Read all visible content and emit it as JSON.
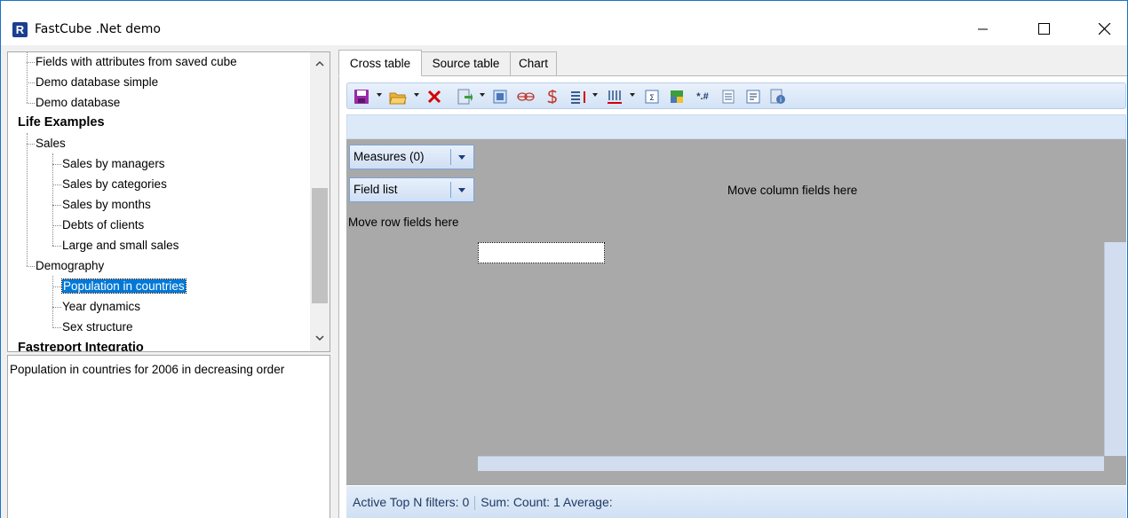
{
  "window": {
    "title": "FastCube .Net demo",
    "app_icon_letter": "R"
  },
  "tree": {
    "items": [
      {
        "label": "Fields with attributes from saved cube"
      },
      {
        "label": "Demo database simple"
      },
      {
        "label": "Demo database"
      },
      {
        "label": "Life Examples"
      },
      {
        "label": "Sales"
      },
      {
        "label": "Sales by managers"
      },
      {
        "label": "Sales by categories"
      },
      {
        "label": "Sales by months"
      },
      {
        "label": "Debts of clients"
      },
      {
        "label": "Large and small sales"
      },
      {
        "label": "Demography"
      },
      {
        "label": "Population in countries"
      },
      {
        "label": "Year dynamics"
      },
      {
        "label": "Sex structure"
      },
      {
        "label": "Fastreport Integratio"
      }
    ],
    "selected": "Population in countries"
  },
  "description": "Population in countries for 2006 in decreasing order",
  "tabs": [
    {
      "label": "Cross table"
    },
    {
      "label": "Source table"
    },
    {
      "label": "Chart"
    }
  ],
  "toolbar": {
    "icons": [
      "save-icon",
      "open-folder-icon",
      "delete-icon",
      "export-icon",
      "grid-icon",
      "infinity-icon",
      "currency-icon",
      "sort-icon",
      "columns-icon",
      "sum-icon",
      "color-scale-icon",
      "number-format-icon",
      "list-icon",
      "properties-icon",
      "info-icon"
    ],
    "number_format_label": "*.#"
  },
  "grid": {
    "measures_label": "Measures (0)",
    "field_list_label": "Field list",
    "column_fields_hint": "Move column fields here",
    "row_fields_hint": "Move row fields here"
  },
  "status": {
    "filters": "Active Top N filters: 0",
    "aggregates": "Sum:  Count: 1 Average:"
  },
  "colors": {
    "selection": "#0078d7",
    "grid_background": "#a9a9a9",
    "toolbar_blue": "#d3e3f6",
    "delete_red": "#d40000",
    "save_purple": "#9a2aa8"
  }
}
